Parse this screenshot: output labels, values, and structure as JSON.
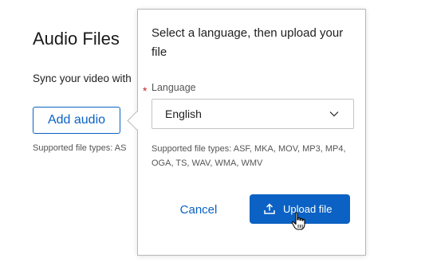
{
  "background": {
    "title": "Audio Files",
    "description": "Sync your video with",
    "add_button_label": "Add audio",
    "supported_types_truncated": "Supported file types: AS"
  },
  "popover": {
    "title": "Select a language, then upload your file",
    "required_marker": "*",
    "language_label": "Language",
    "language_selected": "English",
    "supported_types": "Supported file types: ASF, MKA, MOV, MP3, MP4, OGA, TS, WAV, WMA, WMV",
    "cancel_label": "Cancel",
    "upload_label": "Upload file"
  },
  "icons": {
    "chevron": "chevron-down-icon",
    "upload": "upload-icon",
    "cursor": "hand-pointer-cursor"
  },
  "colors": {
    "accent": "#0b62c4",
    "required": "#c62828"
  }
}
